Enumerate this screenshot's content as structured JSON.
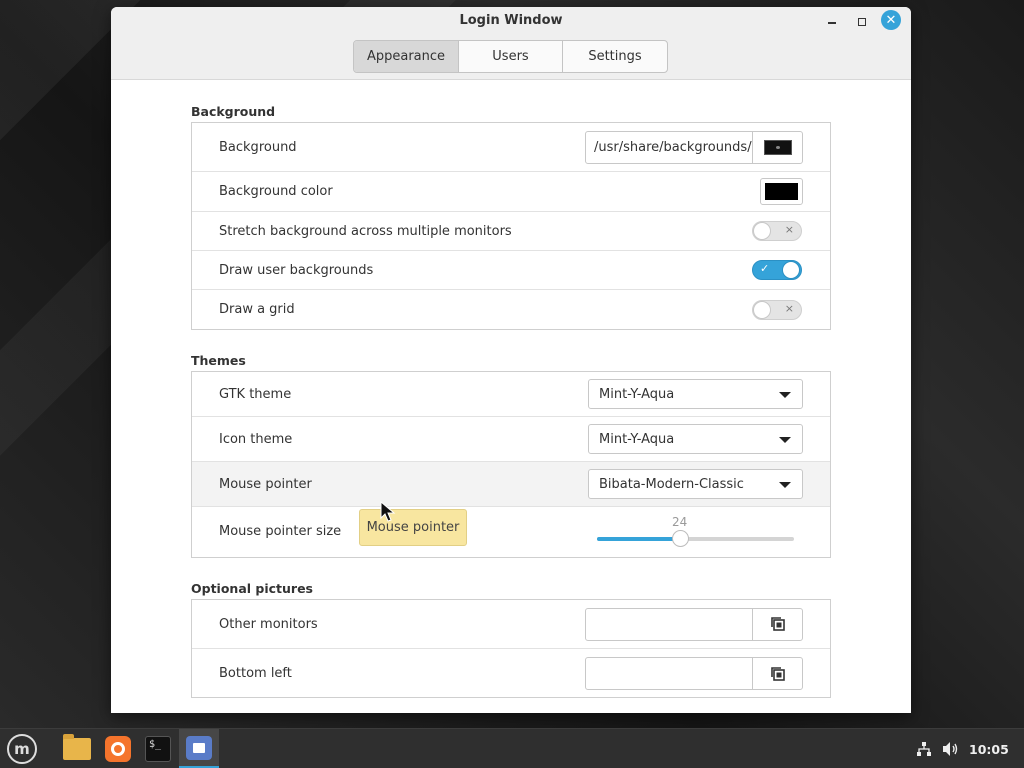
{
  "window": {
    "title": "Login Window",
    "tabs": [
      {
        "label": "Appearance",
        "active": true
      },
      {
        "label": "Users",
        "active": false
      },
      {
        "label": "Settings",
        "active": false
      }
    ]
  },
  "background_section": {
    "title": "Background",
    "rows": {
      "background": {
        "label": "Background",
        "path": "/usr/share/backgrounds/"
      },
      "color": {
        "label": "Background color",
        "value": "#000000"
      },
      "stretch": {
        "label": "Stretch background across multiple monitors",
        "on": false
      },
      "user_bg": {
        "label": "Draw user backgrounds",
        "on": true
      },
      "grid": {
        "label": "Draw a grid",
        "on": false
      }
    }
  },
  "themes_section": {
    "title": "Themes",
    "rows": {
      "gtk": {
        "label": "GTK theme",
        "value": "Mint-Y-Aqua"
      },
      "icon": {
        "label": "Icon theme",
        "value": "Mint-Y-Aqua"
      },
      "pointer": {
        "label": "Mouse pointer",
        "value": "Bibata-Modern-Classic"
      },
      "pointer_size": {
        "label": "Mouse pointer size",
        "value": "24",
        "fraction": 0.42
      }
    }
  },
  "tooltip": {
    "text": "Mouse pointer"
  },
  "optional_section": {
    "title": "Optional pictures",
    "rows": {
      "other": {
        "label": "Other monitors",
        "value": ""
      },
      "bottom_left": {
        "label": "Bottom left",
        "value": ""
      }
    }
  },
  "switch_marks": {
    "on": "✓",
    "off": "×"
  },
  "colors": {
    "accent": "#35a3d9",
    "tooltip": "#f8e6a0"
  },
  "taskbar": {
    "icons": [
      "mint-menu-icon",
      "files-icon",
      "firefox-icon",
      "terminal-icon",
      "login-window-icon"
    ],
    "tray_icons": [
      "network-icon",
      "volume-icon"
    ],
    "clock": "10:05"
  }
}
